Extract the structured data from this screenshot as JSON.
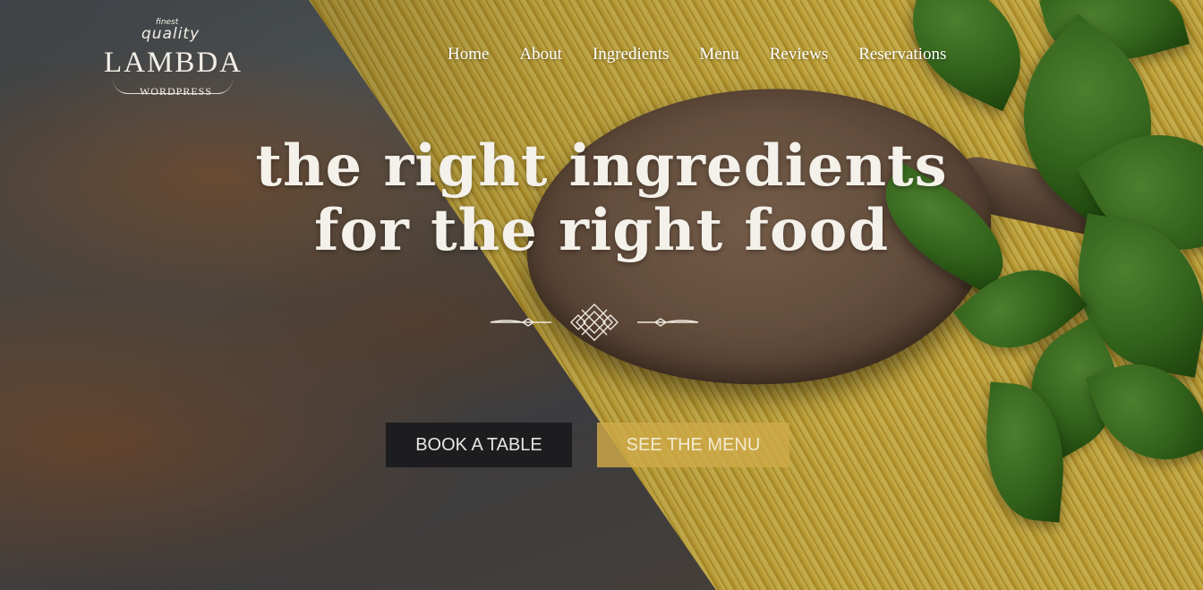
{
  "logo": {
    "small": "finest",
    "quality": "quality",
    "name": "LAMBDA",
    "sub": "WORDPRESS"
  },
  "nav": {
    "items": [
      {
        "label": "Home"
      },
      {
        "label": "About"
      },
      {
        "label": "Ingredients"
      },
      {
        "label": "Menu"
      },
      {
        "label": "Reviews"
      },
      {
        "label": "Reservations"
      }
    ]
  },
  "hero": {
    "headline_line1": "the right ingredients",
    "headline_line2": "for the right food",
    "ornament_icon": "celtic-knot-divider-icon"
  },
  "buttons": {
    "book": "BOOK A TABLE",
    "menu": "SEE THE MENU"
  },
  "colors": {
    "book_button_bg": "#1d1d1f",
    "menu_button_bg": "#ceaa48",
    "text_light": "#f4f0ea"
  }
}
